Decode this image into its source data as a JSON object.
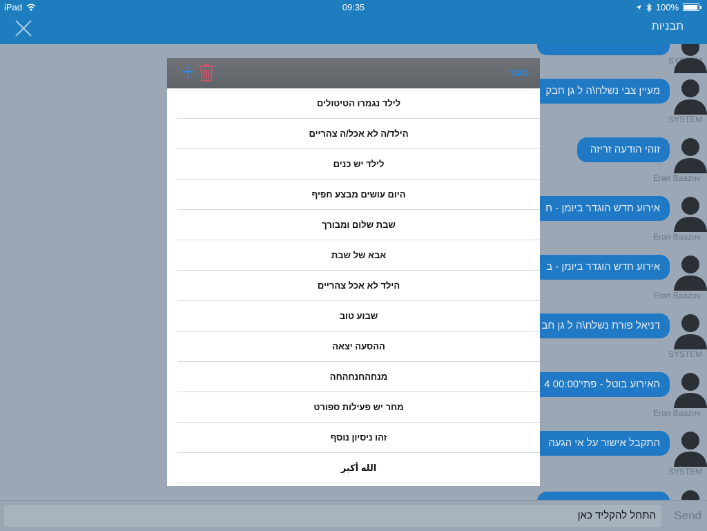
{
  "statusbar": {
    "device": "iPad",
    "time": "09:35",
    "battery": "100%"
  },
  "navbar": {
    "title": "תבניות"
  },
  "chat": {
    "messages": [
      {
        "text": "",
        "sender": "SYSTEM"
      },
      {
        "text": "מעיין צבי נשלח\\ה ל גן חבק",
        "sender": "SYSTEM"
      },
      {
        "text": "זוהי הודעה זריזה",
        "sender": "Eran Baazov"
      },
      {
        "text": "אירוע חדש הוגדר ביומן - ח",
        "sender": "Eran Baazov"
      },
      {
        "text": "אירוע חדש הוגדר ביומן - ב",
        "sender": "Eran Baazov"
      },
      {
        "text": "דניאל פורת נשלח\\ה ל גן חב",
        "sender": "SYSTEM"
      },
      {
        "text": "האירוע בוטל - פתי'00:00 4",
        "sender": "Eran Baazov"
      },
      {
        "text": "התקבל אישור על אי הגעה",
        "sender": "SYSTEM"
      },
      {
        "text": "",
        "sender": ""
      }
    ]
  },
  "input": {
    "placeholder": "התחל להקליד כאן",
    "send_label": "Send"
  },
  "modal": {
    "close_label": "סגור",
    "templates": [
      "לילד נגמרו הטיטולים",
      "הילד/ה לא אכל/ה צהריים",
      "לילד יש כנים",
      "היום עושים מבצע חפיף",
      "שבת שלום ומבורך",
      "אבא של שבת",
      "הילד לא אכל צהריים",
      "שבוע טוב",
      "ההסעה יצאה",
      "מנחהחנחהחה",
      "מחר יש פעילות ספורט",
      "זהו ניסיון נוסף",
      "الله أكبر"
    ]
  },
  "colors": {
    "accent": "#1d7dbf",
    "bubble": "#1f79c4",
    "trash": "#e0506a",
    "link": "#1d8cf0"
  }
}
